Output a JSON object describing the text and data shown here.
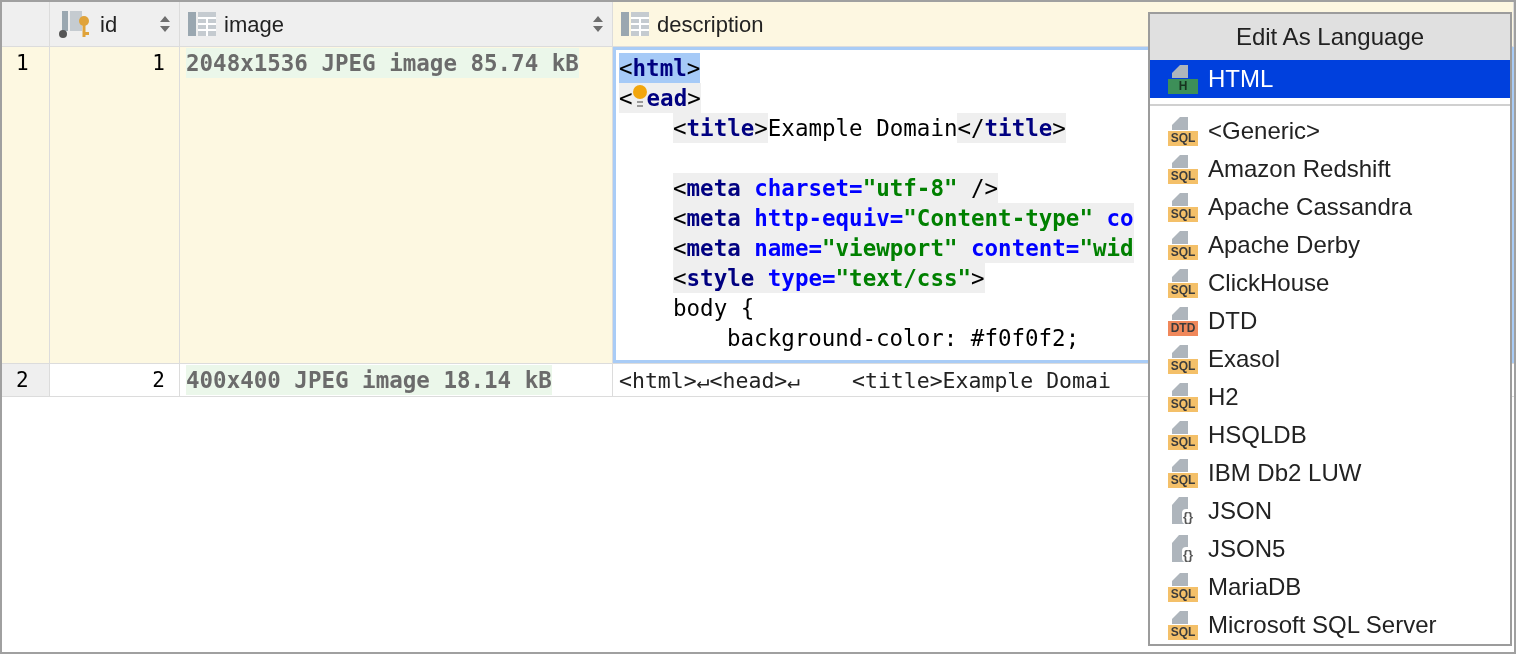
{
  "table": {
    "columns": [
      {
        "label": "id",
        "kind": "key",
        "sortable": true,
        "selected": false
      },
      {
        "label": "image",
        "kind": "column",
        "sortable": true,
        "selected": false
      },
      {
        "label": "description",
        "kind": "column",
        "sortable": false,
        "selected": true
      }
    ],
    "rows": [
      {
        "number": "1",
        "selected": true,
        "id": "1",
        "image": "2048x1536 JPEG image 85.74 kB",
        "description": {
          "kind": "editor",
          "lines": [
            {
              "selected": true,
              "blank_line_before": false,
              "segments": [
                {
                  "text": "<",
                  "kind": "punct",
                  "shaded": true
                },
                {
                  "text": "html",
                  "kind": "tag",
                  "shaded": true
                },
                {
                  "text": ">",
                  "kind": "punct",
                  "shaded": true
                }
              ]
            },
            {
              "selected": false,
              "blank_line_before": false,
              "segments": [
                {
                  "text": "<",
                  "kind": "punct",
                  "shaded": true
                },
                {
                  "kind": "bulb",
                  "shaded": true
                },
                {
                  "text": "ead",
                  "kind": "tag",
                  "shaded": true
                },
                {
                  "text": ">",
                  "kind": "punct",
                  "shaded": true
                }
              ],
              "children": [
                {
                  "selected": false,
                  "blank_line_before": false,
                  "segments": [
                    {
                      "text": "<",
                      "kind": "punct",
                      "shaded": true
                    },
                    {
                      "text": "title",
                      "kind": "tag",
                      "shaded": true
                    },
                    {
                      "text": ">",
                      "kind": "punct",
                      "shaded": true
                    },
                    {
                      "text": "Example Domain",
                      "kind": "punct",
                      "shaded": false
                    },
                    {
                      "text": "</",
                      "kind": "punct",
                      "shaded": true
                    },
                    {
                      "text": "title",
                      "kind": "tag",
                      "shaded": true
                    },
                    {
                      "text": ">",
                      "kind": "punct",
                      "shaded": true
                    }
                  ]
                },
                {
                  "selected": false,
                  "blank_line_before": true,
                  "segments": [
                    {
                      "text": "<",
                      "kind": "punct",
                      "shaded": true
                    },
                    {
                      "text": "meta ",
                      "kind": "tag",
                      "shaded": true
                    },
                    {
                      "text": "charset=",
                      "kind": "attr",
                      "shaded": true
                    },
                    {
                      "text": "\"utf-8\"",
                      "kind": "string",
                      "shaded": true
                    },
                    {
                      "text": " />",
                      "kind": "punct",
                      "shaded": true
                    }
                  ]
                },
                {
                  "selected": false,
                  "blank_line_before": false,
                  "segments": [
                    {
                      "text": "<",
                      "kind": "punct",
                      "shaded": true
                    },
                    {
                      "text": "meta ",
                      "kind": "tag",
                      "shaded": true
                    },
                    {
                      "text": "http-equiv=",
                      "kind": "attr",
                      "shaded": true
                    },
                    {
                      "text": "\"Content-type\" ",
                      "kind": "string",
                      "shaded": true
                    },
                    {
                      "text": "co",
                      "kind": "attr",
                      "shaded": true
                    }
                  ]
                },
                {
                  "selected": false,
                  "blank_line_before": false,
                  "segments": [
                    {
                      "text": "<",
                      "kind": "punct",
                      "shaded": true
                    },
                    {
                      "text": "meta ",
                      "kind": "tag",
                      "shaded": true
                    },
                    {
                      "text": "name=",
                      "kind": "attr",
                      "shaded": true
                    },
                    {
                      "text": "\"viewport\" ",
                      "kind": "string",
                      "shaded": true
                    },
                    {
                      "text": "content=",
                      "kind": "attr",
                      "shaded": true
                    },
                    {
                      "text": "\"wid",
                      "kind": "string",
                      "shaded": true
                    }
                  ]
                },
                {
                  "selected": false,
                  "blank_line_before": false,
                  "segments": [
                    {
                      "text": "<",
                      "kind": "punct",
                      "shaded": true
                    },
                    {
                      "text": "style ",
                      "kind": "tag",
                      "shaded": true
                    },
                    {
                      "text": "type=",
                      "kind": "attr",
                      "shaded": true
                    },
                    {
                      "text": "\"text/css\"",
                      "kind": "string",
                      "shaded": true
                    },
                    {
                      "text": ">",
                      "kind": "punct",
                      "shaded": true
                    }
                  ]
                },
                {
                  "selected": false,
                  "blank_line_before": false,
                  "segments": [
                    {
                      "text": "body {",
                      "kind": "punct",
                      "shaded": false
                    }
                  ],
                  "children": [
                    {
                      "selected": false,
                      "blank_line_before": false,
                      "segments": [
                        {
                          "text": "background-color: #f0f0f2;",
                          "kind": "punct",
                          "shaded": false
                        }
                      ]
                    }
                  ]
                }
              ]
            }
          ]
        }
      },
      {
        "number": "2",
        "selected": false,
        "id": "2",
        "image": "400x400 JPEG image 18.14 kB",
        "description": {
          "kind": "text",
          "text": "<html>↵<head>↵    <title>Example Domai"
        }
      }
    ]
  },
  "popup": {
    "title": "Edit As Language",
    "current": [
      {
        "label": "HTML",
        "kind": "html",
        "badge": "H",
        "selected": true
      }
    ],
    "items": [
      {
        "label": "<Generic>",
        "kind": "sql",
        "badge": "SQL",
        "selected": false
      },
      {
        "label": "Amazon Redshift",
        "kind": "sql",
        "badge": "SQL",
        "selected": false
      },
      {
        "label": "Apache Cassandra",
        "kind": "sql",
        "badge": "SQL",
        "selected": false
      },
      {
        "label": "Apache Derby",
        "kind": "sql",
        "badge": "SQL",
        "selected": false
      },
      {
        "label": "ClickHouse",
        "kind": "sql",
        "badge": "SQL",
        "selected": false
      },
      {
        "label": "DTD",
        "kind": "dtd",
        "badge": "DTD",
        "selected": false
      },
      {
        "label": "Exasol",
        "kind": "sql",
        "badge": "SQL",
        "selected": false
      },
      {
        "label": "H2",
        "kind": "sql",
        "badge": "SQL",
        "selected": false
      },
      {
        "label": "HSQLDB",
        "kind": "sql",
        "badge": "SQL",
        "selected": false
      },
      {
        "label": "IBM Db2 LUW",
        "kind": "sql",
        "badge": "SQL",
        "selected": false
      },
      {
        "label": "JSON",
        "kind": "json",
        "badge": "{}",
        "selected": false
      },
      {
        "label": "JSON5",
        "kind": "json",
        "badge": "{}",
        "selected": false
      },
      {
        "label": "MariaDB",
        "kind": "sql",
        "badge": "SQL",
        "selected": false
      },
      {
        "label": "Microsoft SQL Server",
        "kind": "sql",
        "badge": "SQL",
        "selected": false
      }
    ]
  }
}
